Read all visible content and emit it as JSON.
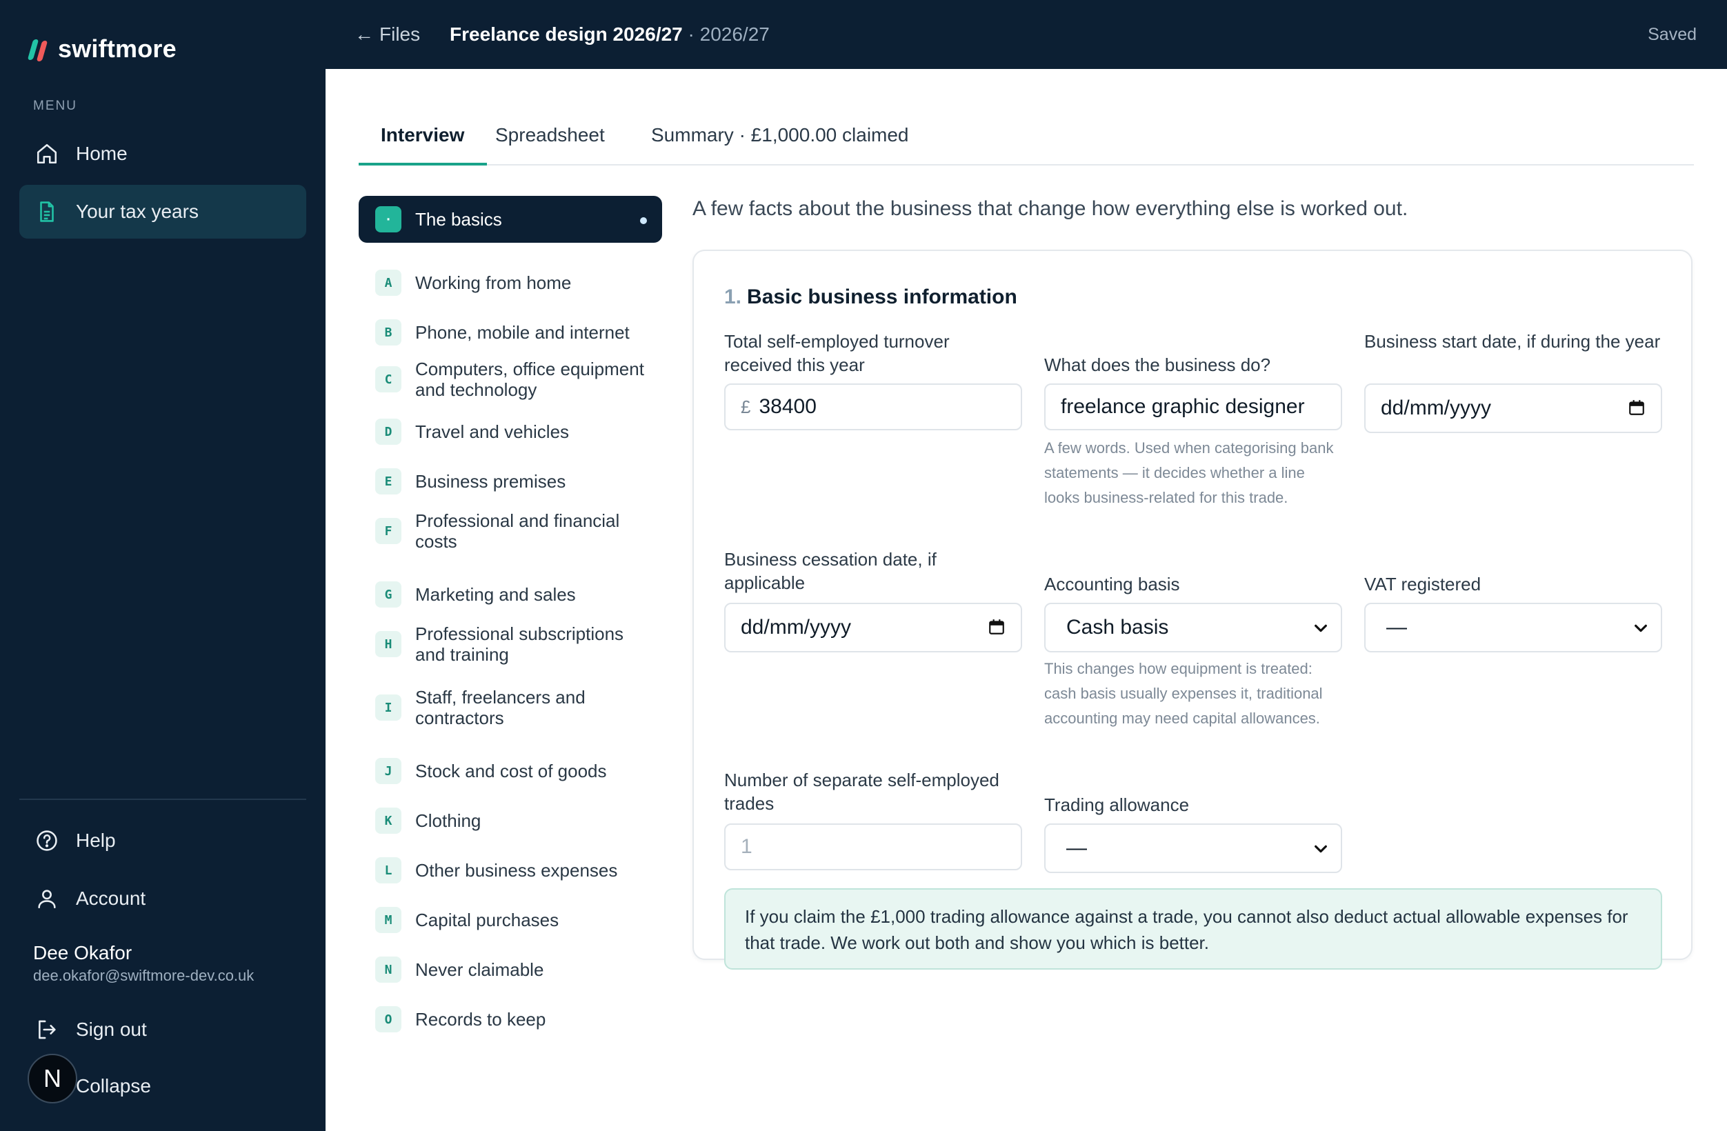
{
  "brand": {
    "name": "swiftmore"
  },
  "sidebar": {
    "menu_label": "MENU",
    "items": [
      {
        "label": "Home",
        "icon": "home-icon"
      },
      {
        "label": "Your tax years",
        "icon": "document-icon"
      }
    ],
    "bottom_items": [
      {
        "label": "Help",
        "icon": "help-icon"
      },
      {
        "label": "Account",
        "icon": "user-icon"
      }
    ],
    "user": {
      "name": "Dee Okafor",
      "email": "dee.okafor@swiftmore-dev.co.uk"
    },
    "sign_out": "Sign out",
    "collapse": "Collapse",
    "badge": "N"
  },
  "topbar": {
    "back": "Files",
    "title": "Freelance design 2026/27",
    "separator": " · ",
    "year": "2026/27",
    "status": "Saved"
  },
  "tabs": [
    {
      "label": "Interview",
      "active": true
    },
    {
      "label": "Spreadsheet",
      "active": false
    },
    {
      "label": "Summary · £1,000.00 claimed",
      "active": false
    }
  ],
  "sections": [
    {
      "badge": "·",
      "label": "The basics",
      "active": true
    },
    {
      "badge": "A",
      "label": "Working from home"
    },
    {
      "badge": "B",
      "label": "Phone, mobile and internet"
    },
    {
      "badge": "C",
      "label": "Computers, office equipment and technology"
    },
    {
      "badge": "D",
      "label": "Travel and vehicles"
    },
    {
      "badge": "E",
      "label": "Business premises"
    },
    {
      "badge": "F",
      "label": "Professional and financial costs"
    },
    {
      "badge": "G",
      "label": "Marketing and sales"
    },
    {
      "badge": "H",
      "label": "Professional subscriptions and training"
    },
    {
      "badge": "I",
      "label": "Staff, freelancers and contractors"
    },
    {
      "badge": "J",
      "label": "Stock and cost of goods"
    },
    {
      "badge": "K",
      "label": "Clothing"
    },
    {
      "badge": "L",
      "label": "Other business expenses"
    },
    {
      "badge": "M",
      "label": "Capital purchases"
    },
    {
      "badge": "N",
      "label": "Never claimable"
    },
    {
      "badge": "O",
      "label": "Records to keep"
    }
  ],
  "content": {
    "intro": "A few facts about the business that change how everything else is worked out.",
    "card": {
      "number": "1.",
      "title": "Basic business information",
      "fields": {
        "turnover": {
          "label": "Total self-employed turnover received this year",
          "prefix": "£",
          "value": "38400"
        },
        "business_do": {
          "label": "What does the business do?",
          "value": "freelance graphic designer",
          "help": "A few words. Used when categorising bank statements — it decides whether a line looks business-related for this trade."
        },
        "start_date": {
          "label": "Business start date, if during the year",
          "value": "dd/mm/yyyy"
        },
        "cessation_date": {
          "label": "Business cessation date, if applicable",
          "value": "dd/mm/yyyy"
        },
        "accounting_basis": {
          "label": "Accounting basis",
          "value": "Cash basis",
          "help": "This changes how equipment is treated: cash basis usually expenses it, traditional accounting may need capital allowances."
        },
        "vat": {
          "label": "VAT registered",
          "value": "—"
        },
        "trades": {
          "label": "Number of separate self-employed trades",
          "placeholder": "1"
        },
        "trading_allowance": {
          "label": "Trading allowance",
          "value": "—"
        }
      },
      "notice": "If you claim the £1,000 trading allowance against a trade, you cannot also deduct actual allowable expenses for that trade. We work out both and show you which is better."
    }
  }
}
